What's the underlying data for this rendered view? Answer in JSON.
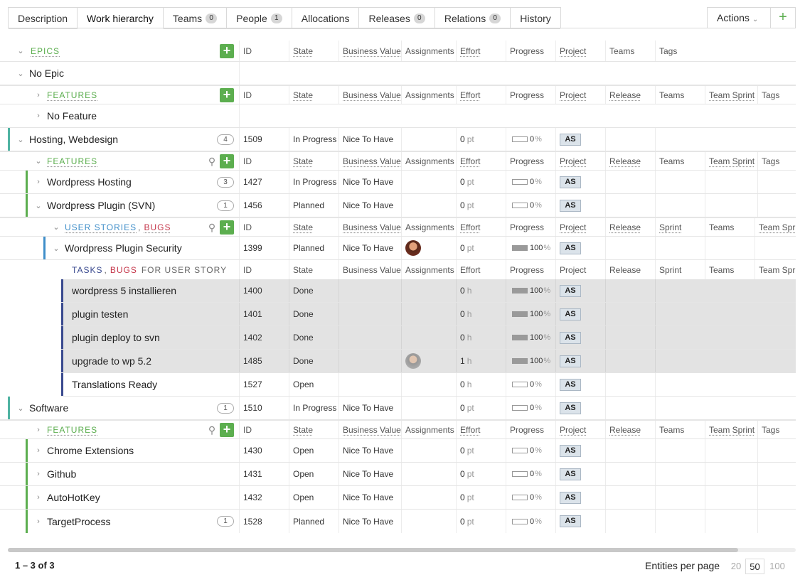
{
  "tabs": [
    {
      "label": "Description"
    },
    {
      "label": "Work hierarchy"
    },
    {
      "label": "Teams",
      "count": "0"
    },
    {
      "label": "People",
      "count": "1"
    },
    {
      "label": "Allocations"
    },
    {
      "label": "Releases",
      "count": "0"
    },
    {
      "label": "Relations",
      "count": "0"
    },
    {
      "label": "History"
    }
  ],
  "actions_label": "Actions",
  "epics": {
    "title": "EPICS",
    "cols": [
      "ID",
      "State",
      "Business Value",
      "Assignments",
      "Effort",
      "Progress",
      "Project",
      "Teams",
      "Tags"
    ]
  },
  "no_epic": "No Epic",
  "features_header": {
    "title": "FEATURES",
    "cols": [
      "ID",
      "State",
      "Business Value",
      "Assignments",
      "Effort",
      "Progress",
      "Project",
      "Release",
      "Teams",
      "Team Sprint",
      "Tags"
    ]
  },
  "no_feature": "No Feature",
  "us_header": {
    "t1": "USER STORIES",
    "t2": "BUGS",
    "cols": [
      "ID",
      "State",
      "Business Value",
      "Assignments",
      "Effort",
      "Progress",
      "Project",
      "Release",
      "Sprint",
      "Teams",
      "Team Sprint"
    ]
  },
  "task_header": {
    "t1": "TASKS",
    "t2": "BUGS",
    "t3": "FOR USER STORY",
    "cols": [
      "ID",
      "State",
      "Business Value",
      "Assignments",
      "Effort",
      "Progress",
      "Project",
      "Release",
      "Sprint",
      "Teams",
      "Team Sprint"
    ]
  },
  "rows": [
    {
      "name": "Hosting, Webdesign",
      "count": "4",
      "id": "1509",
      "state": "In Progress",
      "bv": "Nice To Have",
      "effort": "0",
      "unit": "pt",
      "progress": "0",
      "project": "AS"
    },
    {
      "name": "Wordpress Hosting",
      "count": "3",
      "id": "1427",
      "state": "In Progress",
      "bv": "Nice To Have",
      "effort": "0",
      "unit": "pt",
      "progress": "0",
      "project": "AS"
    },
    {
      "name": "Wordpress Plugin (SVN)",
      "count": "1",
      "id": "1456",
      "state": "Planned",
      "bv": "Nice To Have",
      "effort": "0",
      "unit": "pt",
      "progress": "0",
      "project": "AS"
    },
    {
      "name": "Wordpress Plugin Security",
      "id": "1399",
      "state": "Planned",
      "bv": "Nice To Have",
      "effort": "0",
      "unit": "pt",
      "progress": "100",
      "project": "AS"
    },
    {
      "name": "wordpress 5 installieren",
      "id": "1400",
      "state": "Done",
      "effort": "0",
      "unit": "h",
      "progress": "100",
      "project": "AS"
    },
    {
      "name": "plugin testen",
      "id": "1401",
      "state": "Done",
      "effort": "0",
      "unit": "h",
      "progress": "100",
      "project": "AS"
    },
    {
      "name": "plugin deploy to svn",
      "id": "1402",
      "state": "Done",
      "effort": "0",
      "unit": "h",
      "progress": "100",
      "project": "AS"
    },
    {
      "name": "upgrade to wp 5.2",
      "id": "1485",
      "state": "Done",
      "effort": "1",
      "unit": "h",
      "progress": "100",
      "project": "AS"
    },
    {
      "name": "Translations Ready",
      "id": "1527",
      "state": "Open",
      "effort": "0",
      "unit": "h",
      "progress": "0",
      "project": "AS"
    },
    {
      "name": "Software",
      "count": "1",
      "id": "1510",
      "state": "In Progress",
      "bv": "Nice To Have",
      "effort": "0",
      "unit": "pt",
      "progress": "0",
      "project": "AS"
    },
    {
      "name": "Chrome Extensions",
      "id": "1430",
      "state": "Open",
      "bv": "Nice To Have",
      "effort": "0",
      "unit": "pt",
      "progress": "0",
      "project": "AS"
    },
    {
      "name": "Github",
      "id": "1431",
      "state": "Open",
      "bv": "Nice To Have",
      "effort": "0",
      "unit": "pt",
      "progress": "0",
      "project": "AS"
    },
    {
      "name": "AutoHotKey",
      "id": "1432",
      "state": "Open",
      "bv": "Nice To Have",
      "effort": "0",
      "unit": "pt",
      "progress": "0",
      "project": "AS"
    },
    {
      "name": "TargetProcess",
      "count": "1",
      "id": "1528",
      "state": "Planned",
      "bv": "Nice To Have",
      "effort": "0",
      "unit": "pt",
      "progress": "0",
      "project": "AS"
    }
  ],
  "pct": "%",
  "footer": {
    "count": "1 – 3 of 3",
    "epp_label": "Entities per page",
    "sizes": [
      "20",
      "50",
      "100"
    ]
  },
  "colors": {
    "green": "#5cae4f",
    "blue": "#3f8ec9",
    "red": "#c5374b",
    "epic_bar": "#4fb3a2",
    "task_bar": "#3a4a8f"
  }
}
